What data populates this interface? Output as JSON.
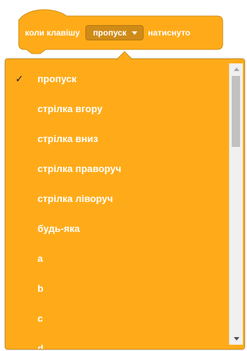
{
  "block": {
    "text_before": "коли клавішу",
    "selected_key": "пропуск",
    "text_after": "натиснуто",
    "color": "#ffab19",
    "border_color": "#cf8b17",
    "field_color": "#cf8b17"
  },
  "menu": {
    "items": [
      {
        "label": "пропуск",
        "checked": true
      },
      {
        "label": "стрілка вгору",
        "checked": false
      },
      {
        "label": "стрілка вниз",
        "checked": false
      },
      {
        "label": "стрілка праворуч",
        "checked": false
      },
      {
        "label": "стрілка ліворуч",
        "checked": false
      },
      {
        "label": "будь-яка",
        "checked": false
      },
      {
        "label": "a",
        "checked": false
      },
      {
        "label": "b",
        "checked": false
      },
      {
        "label": "c",
        "checked": false
      },
      {
        "label": "d",
        "checked": false
      }
    ],
    "check_mark": "✓",
    "scroll_position": 0
  },
  "icons": {
    "check": "checkmark-icon",
    "dropdown_caret": "caret-down-icon",
    "scroll_up": "scroll-up-arrow-icon",
    "scroll_down": "scroll-down-arrow-icon"
  }
}
